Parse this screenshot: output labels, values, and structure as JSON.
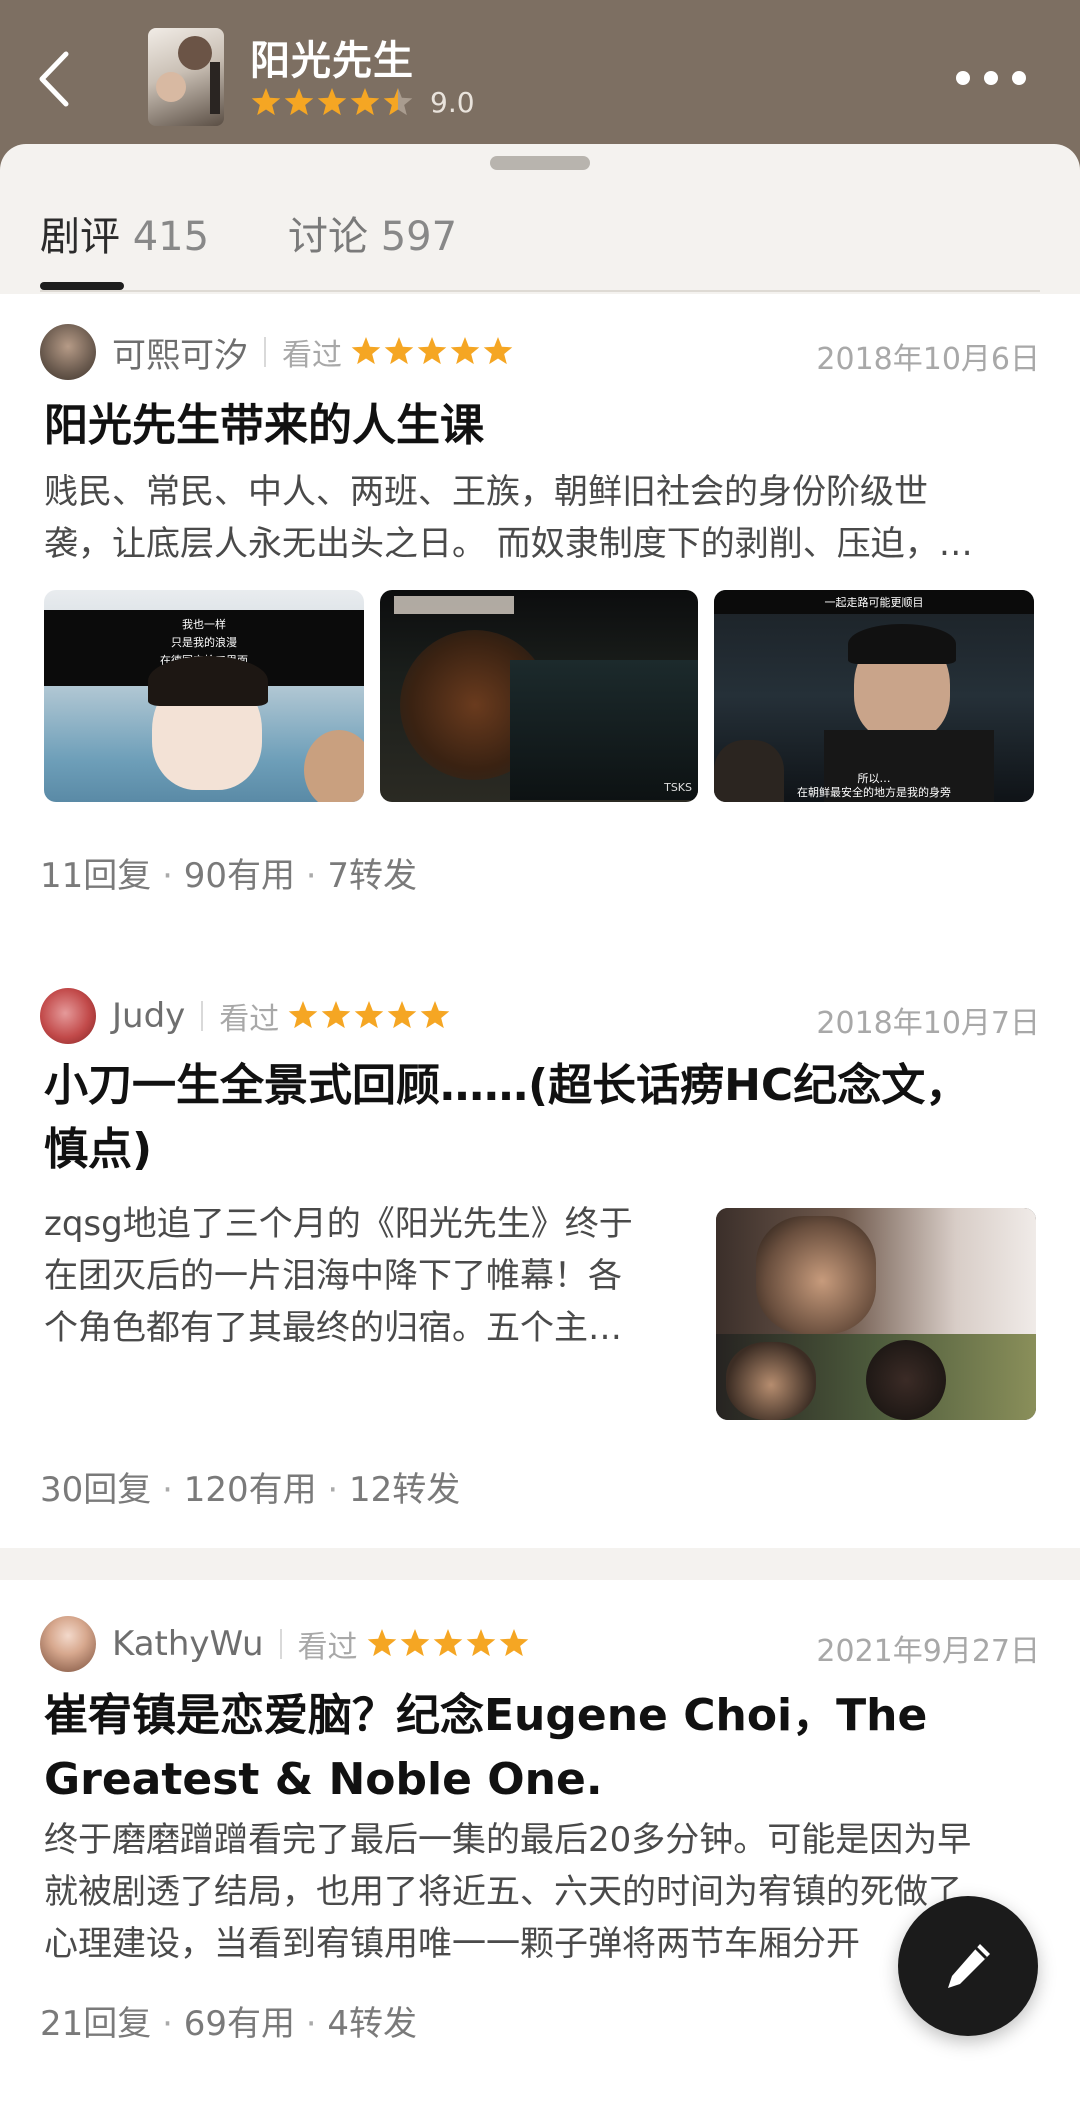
{
  "header": {
    "title": "阳光先生",
    "rating_value": 9.0,
    "score_text": "9.0",
    "star_fill": [
      1,
      1,
      1,
      1,
      0.5
    ]
  },
  "tabs": [
    {
      "label": "剧评",
      "count": "415",
      "active": true
    },
    {
      "label": "讨论",
      "count": "597",
      "active": false
    }
  ],
  "reviews": [
    {
      "author": "可熙可汐",
      "status": "看过",
      "stars": 5,
      "date": "2018年10月6日",
      "title": "阳光先生带来的人生课",
      "excerpt_lines": [
        "贱民、常民、中人、两班、王族，朝鲜旧社会的身份阶级世",
        "袭，让底层人永无出头之日。 而奴隶制度下的剥削、压迫，…"
      ],
      "images": [
        {
          "caption_lines": [
            "我也一样",
            "只是我的浪漫",
            "在德国产枪口里面"
          ]
        },
        {
          "caption_lines": [
            "TSKS"
          ]
        },
        {
          "caption_lines": [
            "一起走路可能更顺目",
            "所以…",
            "在朝鲜最安全的地方是我的身旁"
          ]
        }
      ],
      "stats": {
        "replies": "11回复",
        "useful": "90有用",
        "shares": "7转发"
      }
    },
    {
      "author": "Judy",
      "status": "看过",
      "stars": 5,
      "date": "2018年10月7日",
      "title_lines": [
        "小刀一生全景式回顾……(超长话痨HC纪念文，",
        "慎点)"
      ],
      "excerpt_lines": [
        "zqsg地追了三个月的《阳光先生》终于",
        "在团灭后的一片泪海中降下了帷幕！各",
        "个角色都有了其最终的归宿。五个主…"
      ],
      "stats": {
        "replies": "30回复",
        "useful": "120有用",
        "shares": "12转发"
      }
    },
    {
      "author": "KathyWu",
      "status": "看过",
      "stars": 5,
      "date": "2021年9月27日",
      "title_lines": [
        "崔宥镇是恋爱脑？纪念Eugene Choi，The",
        "Greatest & Noble One."
      ],
      "excerpt_lines": [
        "终于磨磨蹭蹭看完了最后一集的最后20多分钟。可能是因为早",
        "就被剧透了结局，也用了将近五、六天的时间为宥镇的死做了",
        "心理建设，当看到宥镇用唯一一颗子弹将两节车厢分开"
      ],
      "stats": {
        "replies": "21回复",
        "useful": "69有用",
        "shares": "4转发"
      }
    }
  ],
  "icons": {
    "back": "chevron-left-icon",
    "more": "more-horizontal-icon",
    "star": "star-icon",
    "compose": "pencil-icon"
  },
  "colors": {
    "header_bg": "#7d6f62",
    "star": "#f5a623",
    "fab_bg": "#1b1b1b"
  }
}
